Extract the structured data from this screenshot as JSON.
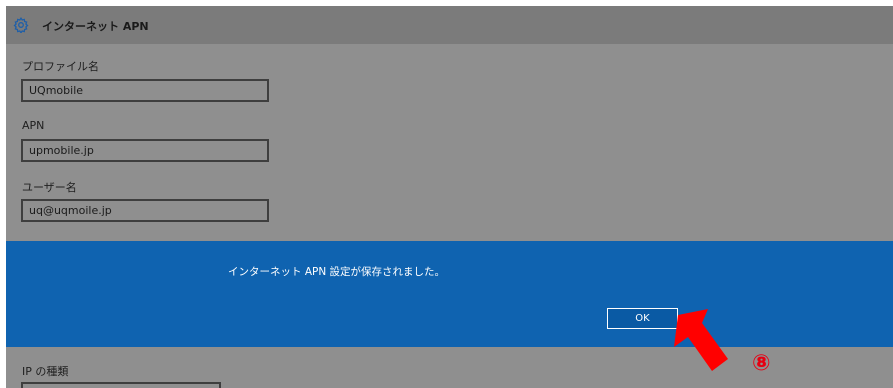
{
  "window": {
    "title": "インターネット APN",
    "title_icon": "gear-icon"
  },
  "fields": [
    {
      "label": "プロファイル名",
      "value": "UQmobile"
    },
    {
      "label": "APN",
      "value": "upmobile.jp"
    },
    {
      "label": "ユーザー名",
      "value": "uq@uqmoile.jp"
    }
  ],
  "ip_type": {
    "label": "IP の種類"
  },
  "dialog": {
    "message": "インターネット APN 設定が保存されました。",
    "ok_label": "OK"
  },
  "annotation": {
    "arrow_icon": "red-arrow-icon",
    "arrow_color": "#ff0000",
    "step_label": "⑧",
    "step_color": "#e60012"
  },
  "colors": {
    "dialog_bg": "#0f63b0",
    "window_bg": "#8f8f8f",
    "titlebar_bg": "#7b7b7b"
  }
}
